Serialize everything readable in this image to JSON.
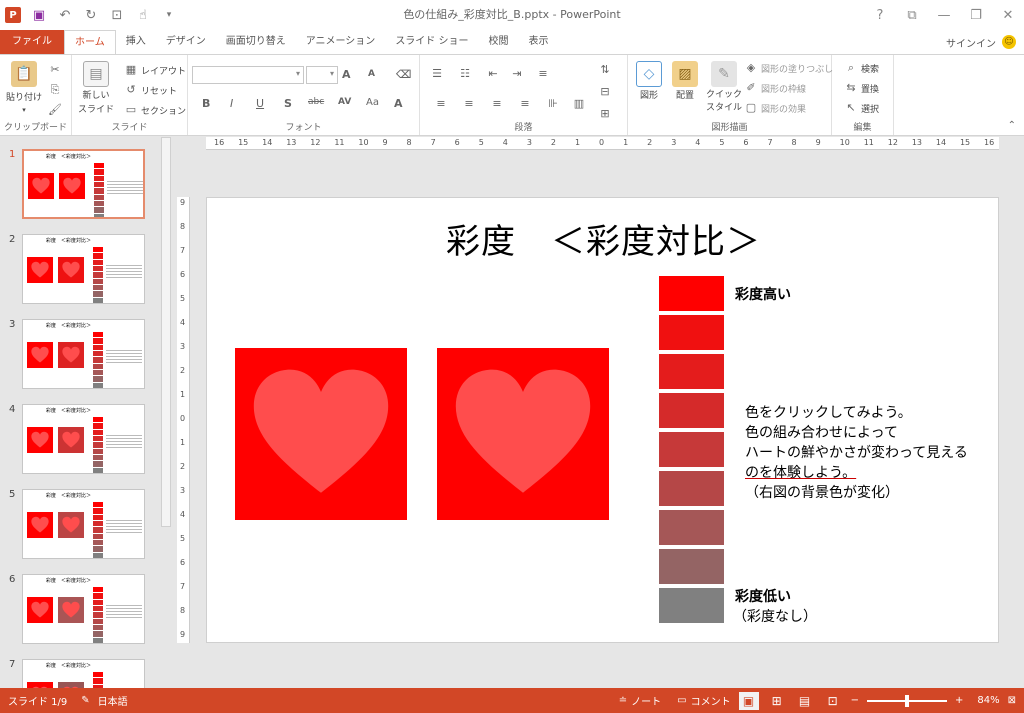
{
  "app": {
    "title": "色の仕組み_彩度対比_B.pptx - PowerPoint",
    "logo_letter": "P",
    "signin": "サインイン"
  },
  "qat": [
    "save-icon",
    "undo-icon",
    "redo-icon",
    "present-icon",
    "touch-icon",
    "customize-icon"
  ],
  "window_controls": [
    "?",
    "⧉",
    "—",
    "❐",
    "✕"
  ],
  "tabs": [
    {
      "label": "ファイル"
    },
    {
      "label": "ホーム"
    },
    {
      "label": "挿入"
    },
    {
      "label": "デザイン"
    },
    {
      "label": "画面切り替え"
    },
    {
      "label": "アニメーション"
    },
    {
      "label": "スライド ショー"
    },
    {
      "label": "校閲"
    },
    {
      "label": "表示"
    }
  ],
  "ribbon": {
    "clipboard": {
      "label": "クリップボード",
      "paste": "貼り付け"
    },
    "slides": {
      "label": "スライド",
      "new_slide_1": "新しい",
      "new_slide_2": "スライド",
      "layout": "レイアウト",
      "reset": "リセット",
      "section": "セクション"
    },
    "font": {
      "label": "フォント"
    },
    "paragraph": {
      "label": "段落"
    },
    "drawing": {
      "label": "図形描画",
      "shapes": "図形",
      "arrange": "配置",
      "quick_style_1": "クイック",
      "quick_style_2": "スタイル",
      "fill": "図形の塗りつぶし",
      "outline": "図形の枠線",
      "effects": "図形の効果"
    },
    "editing": {
      "label": "編集",
      "find": "検索",
      "replace": "置換",
      "select": "選択"
    }
  },
  "thumbnails": [
    {
      "num": "1",
      "title": "彩度　＜彩度対比＞",
      "right_bg": "#ff0000",
      "selected": true
    },
    {
      "num": "2",
      "title": "彩度　＜彩度対比＞",
      "right_bg": "#ee1111"
    },
    {
      "num": "3",
      "title": "彩度　＜彩度対比＞",
      "right_bg": "#dd2222"
    },
    {
      "num": "4",
      "title": "彩度　＜彩度対比＞",
      "right_bg": "#cc3333"
    },
    {
      "num": "5",
      "title": "彩度　＜彩度対比＞",
      "right_bg": "#bb4444"
    },
    {
      "num": "6",
      "title": "彩度　＜彩度対比＞",
      "right_bg": "#aa5555"
    },
    {
      "num": "7",
      "title": "彩度　＜彩度対比＞",
      "right_bg": "#995555"
    }
  ],
  "ruler": {
    "h_ticks": [
      "16",
      "15",
      "14",
      "13",
      "12",
      "11",
      "10",
      "9",
      "8",
      "7",
      "6",
      "5",
      "4",
      "3",
      "2",
      "1",
      "0",
      "1",
      "2",
      "3",
      "4",
      "5",
      "6",
      "7",
      "8",
      "9",
      "10",
      "11",
      "12",
      "13",
      "14",
      "15",
      "16"
    ],
    "v_ticks": [
      "9",
      "8",
      "7",
      "6",
      "5",
      "4",
      "3",
      "2",
      "1",
      "0",
      "1",
      "2",
      "3",
      "4",
      "5",
      "6",
      "7",
      "8",
      "9"
    ]
  },
  "slide": {
    "title": "彩度　＜彩度対比＞",
    "left_box_color": "#ff0000",
    "right_box_color": "#ff0000",
    "heart_color": "#ff4d4d",
    "saturation_swatches": [
      "#ff0000",
      "#f01010",
      "#e41c1c",
      "#d52a2a",
      "#c63939",
      "#b54747",
      "#a55757",
      "#946464",
      "#808080"
    ],
    "label_high": "彩度高い",
    "label_low_1": "彩度低い",
    "label_low_2": "（彩度なし）",
    "instructions": [
      "色をクリックしてみよう。",
      "色の組み合わせによって",
      "ハートの鮮やかさが変わって見える",
      "のを体験しよう。",
      "（右図の背景色が変化）"
    ]
  },
  "status": {
    "slide": "スライド 1/9",
    "language": "日本語",
    "notes": "ノート",
    "comments": "コメント",
    "zoom": "84%"
  }
}
